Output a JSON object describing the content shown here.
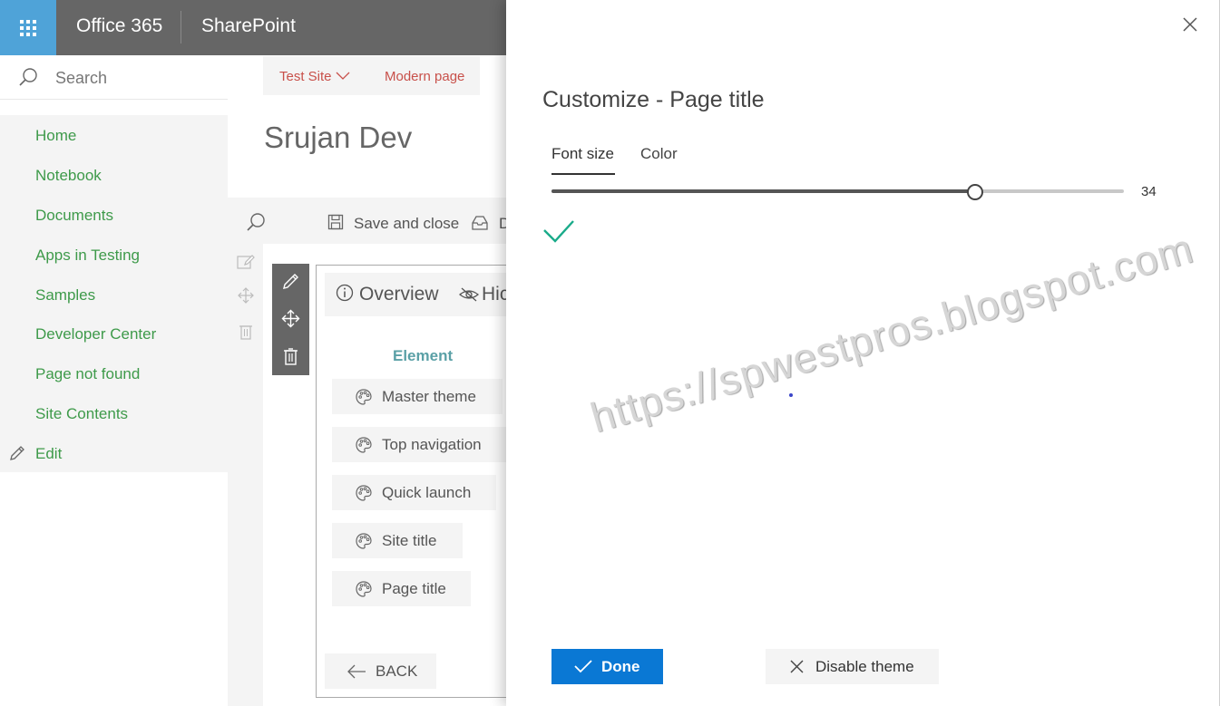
{
  "suite_bar": {
    "brand": "Office 365",
    "app": "SharePoint",
    "waffle_icon": "app-launcher-icon"
  },
  "search": {
    "placeholder": "Search"
  },
  "nav": {
    "items": [
      {
        "label": "Home"
      },
      {
        "label": "Notebook"
      },
      {
        "label": "Documents"
      },
      {
        "label": "Apps in Testing"
      },
      {
        "label": "Samples"
      },
      {
        "label": "Developer Center"
      },
      {
        "label": "Page not found"
      },
      {
        "label": "Site Contents"
      }
    ],
    "edit_label": "Edit"
  },
  "breadcrumb": {
    "site": "Test Site",
    "page": "Modern page"
  },
  "site_title": "Srujan Dev",
  "command_bar": {
    "save_close": "Save and close",
    "discard": "D"
  },
  "webpart": {
    "tabs": {
      "overview": "Overview",
      "hide": "Hic"
    },
    "element_heading": "Element",
    "elements": [
      "Master theme",
      "Top navigation",
      "Quick launch",
      "Site title",
      "Page title"
    ],
    "back": "BACK"
  },
  "customize_panel": {
    "title": "Customize - Page title",
    "tabs": {
      "font_size": "Font size",
      "color": "Color"
    },
    "active_tab": "Font size",
    "slider": {
      "value": "34",
      "fraction": 0.74
    },
    "done": "Done",
    "disable": "Disable theme",
    "watermark": "https://spwestpros.blogspot.com"
  },
  "colors": {
    "suite_bar": "#666666",
    "waffle": "#4fa3d8",
    "nav_link": "#3e9a4a",
    "breadcrumb_link": "#c8504a",
    "primary_button": "#0a78d4",
    "check": "#1aab8a"
  }
}
